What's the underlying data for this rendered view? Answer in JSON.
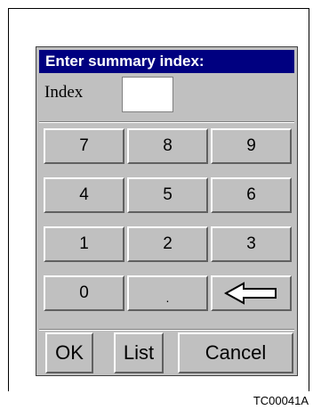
{
  "dialog": {
    "title": "Enter summary index:",
    "index_label": "Index",
    "index_value": ""
  },
  "keypad": {
    "k7": "7",
    "k8": "8",
    "k9": "9",
    "k4": "4",
    "k5": "5",
    "k6": "6",
    "k1": "1",
    "k2": "2",
    "k3": "3",
    "k0": "0",
    "kdot": ".",
    "backspace_icon": "left-arrow-icon"
  },
  "actions": {
    "ok_label": "OK",
    "list_label": "List",
    "cancel_label": "Cancel"
  },
  "figure_id": "TC00041A",
  "colors": {
    "titlebar_bg": "#000080",
    "titlebar_text": "#ffffff",
    "dialog_bg": "#c0c0c0"
  }
}
